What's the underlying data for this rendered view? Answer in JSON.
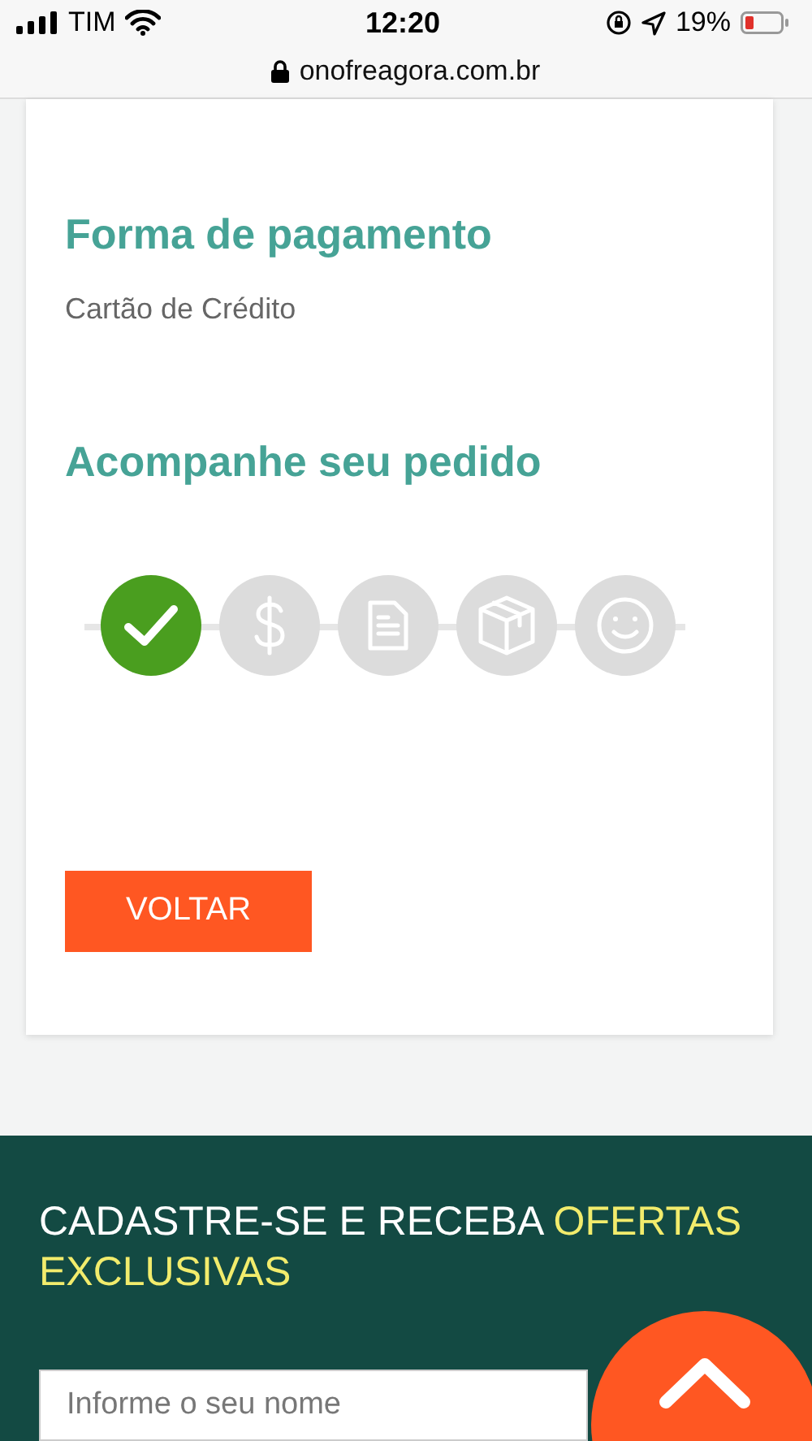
{
  "status_bar": {
    "carrier": "TIM",
    "time": "12:20",
    "battery": "19%"
  },
  "address_bar": {
    "url": "onofreagora.com.br"
  },
  "payment": {
    "title": "Forma de pagamento",
    "method": "Cartão de Crédito"
  },
  "tracking": {
    "title": "Acompanhe seu pedido",
    "steps": [
      {
        "kind": "check",
        "done": true
      },
      {
        "kind": "money",
        "done": false
      },
      {
        "kind": "document",
        "done": false
      },
      {
        "kind": "box",
        "done": false
      },
      {
        "kind": "smile",
        "done": false
      }
    ]
  },
  "back_button": "VOLTAR",
  "newsletter": {
    "title": "CADASTRE-SE E RECEBA **OFERTAS EXCLUSIVAS**",
    "name_placeholder": "Informe o seu nome"
  }
}
